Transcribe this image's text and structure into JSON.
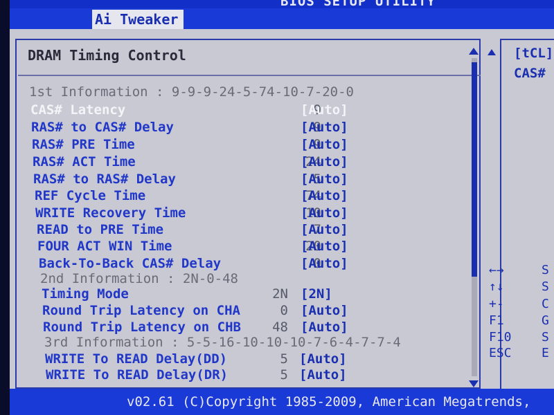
{
  "title_bar": {
    "text": "BIOS SETUP UTILITY"
  },
  "tabs": [
    {
      "label": "Ai Tweaker",
      "active": true
    }
  ],
  "panel": {
    "heading": "DRAM Timing Control",
    "info1": "1st Information : 9-9-9-24-5-74-10-7-20-0",
    "rows": [
      {
        "label": "CAS# Latency",
        "value": "9",
        "option": "[Auto]"
      },
      {
        "label": "RAS# to CAS# Delay",
        "value": "9",
        "option": "[Auto]"
      },
      {
        "label": "RAS# PRE Time",
        "value": "9",
        "option": "[Auto]"
      },
      {
        "label": "RAS# ACT Time",
        "value": "24",
        "option": "[Auto]"
      },
      {
        "label": "RAS# to RAS# Delay",
        "value": "5",
        "option": "[Auto]"
      },
      {
        "label": "REF Cycle Time",
        "value": "74",
        "option": "[Auto]"
      },
      {
        "label": "WRITE Recovery Time",
        "value": "10",
        "option": "[Auto]"
      },
      {
        "label": "READ to PRE Time",
        "value": "7",
        "option": "[Auto]"
      },
      {
        "label": "FOUR ACT WIN Time",
        "value": "20",
        "option": "[Auto]"
      },
      {
        "label": "Back-To-Back CAS# Delay",
        "value": "0",
        "option": "[Auto]"
      }
    ],
    "info2": "2nd Information : 2N-0-48",
    "rows2": [
      {
        "label": "Timing Mode",
        "value": "2N",
        "option": "[2N]"
      },
      {
        "label": "Round Trip Latency on CHA",
        "value": "0",
        "option": "[Auto]"
      },
      {
        "label": "Round Trip Latency on CHB",
        "value": "48",
        "option": "[Auto]"
      }
    ],
    "info3": "3rd Information : 5-5-16-10-10-10-7-6-4-7-7-4",
    "rows3": [
      {
        "label": "WRITE To READ Delay(DD)",
        "value": "5",
        "option": "[Auto]"
      },
      {
        "label": "WRITE To READ Delay(DR)",
        "value": "5",
        "option": "[Auto]"
      }
    ]
  },
  "help": {
    "line1": "[tCL]",
    "line2": "CAS#"
  },
  "keys": [
    {
      "key": "←→",
      "desc": "S"
    },
    {
      "key": "↑↓",
      "desc": "S"
    },
    {
      "key": "+-",
      "desc": "C"
    },
    {
      "key": "F1",
      "desc": "G"
    },
    {
      "key": "F10",
      "desc": "S"
    },
    {
      "key": "ESC",
      "desc": "E"
    }
  ],
  "footer": {
    "copyright": "v02.61 (C)Copyright 1985-2009, American Megatrends,"
  }
}
